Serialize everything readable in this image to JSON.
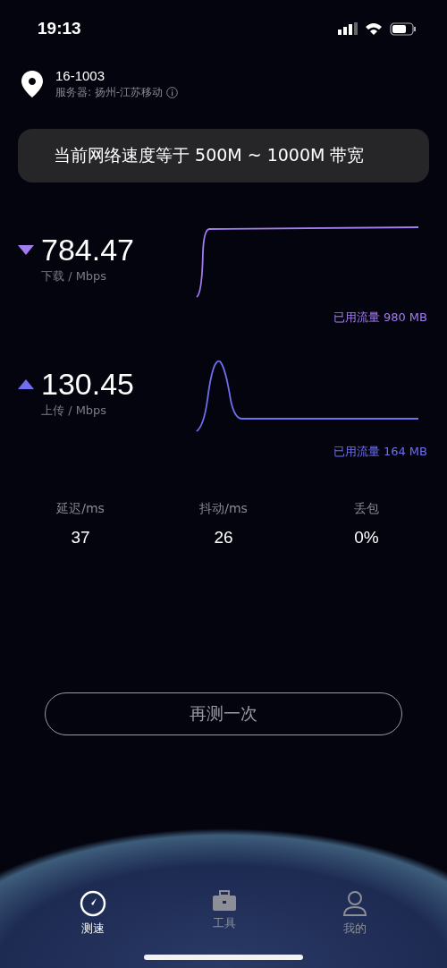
{
  "status_bar": {
    "time": "19:13"
  },
  "location": {
    "name": "16-1003",
    "server": "服务器: 扬州-江苏移动"
  },
  "banner": "当前网络速度等于 500M ~ 1000M 带宽",
  "speeds": [
    {
      "kind": "download",
      "value": "784.47",
      "unit": "下载 / Mbps",
      "traffic": "已用流量 980 MB",
      "color": "#a37cf0"
    },
    {
      "kind": "upload",
      "value": "130.45",
      "unit": "上传 / Mbps",
      "traffic": "已用流量 164 MB",
      "color": "#6f6ff0"
    }
  ],
  "stats": [
    {
      "label": "延迟/ms",
      "value": "37"
    },
    {
      "label": "抖动/ms",
      "value": "26"
    },
    {
      "label": "丢包",
      "value": "0%"
    }
  ],
  "retest_button": "再测一次",
  "tabs": [
    {
      "kind": "speed",
      "label": "测速",
      "selected": true
    },
    {
      "kind": "tools",
      "label": "工具",
      "selected": false
    },
    {
      "kind": "me",
      "label": "我的",
      "selected": false
    }
  ]
}
